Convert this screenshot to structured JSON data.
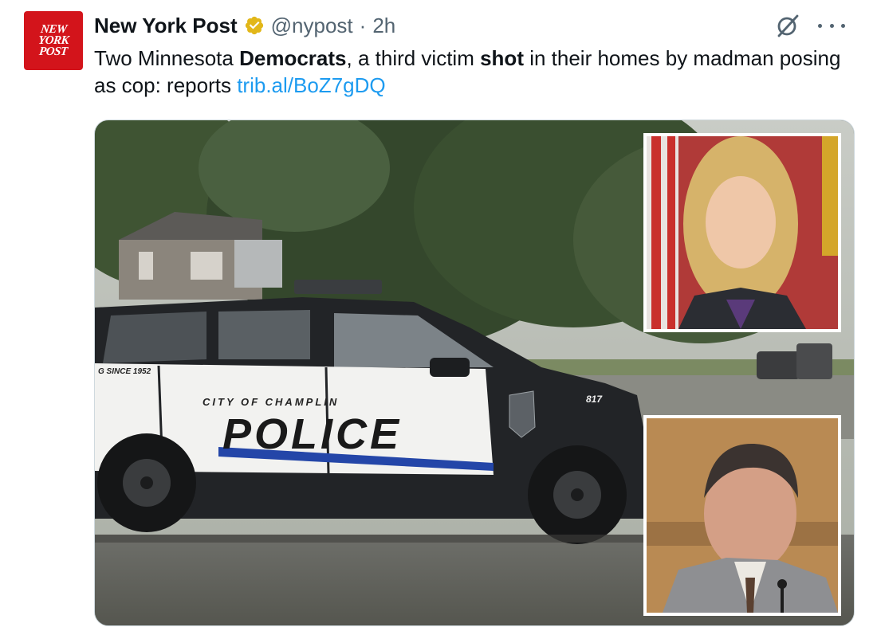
{
  "author": {
    "name": "New York Post",
    "handle": "@nypost",
    "separator": "·",
    "time": "2h",
    "avatar_lines": [
      "NEW",
      "YORK",
      "POST"
    ],
    "verified_badge": "verified-gold-icon",
    "brand_color": "#d3141b"
  },
  "tweet": {
    "text_parts": {
      "p1": "Two Minnesota ",
      "p2": "Democrats",
      "p3": ", a third victim ",
      "p4": "shot",
      "p5": " in their homes by madman posing as cop: reports ",
      "link": "trib.al/BoZ7gDQ"
    },
    "link_color": "#1d9bf0"
  },
  "media": {
    "car_text": {
      "city": "CITY OF CHAMPLIN",
      "police": "POLICE",
      "unit": "817",
      "since": "G SINCE 1952"
    }
  },
  "actions": {
    "grok_icon": "grok-icon",
    "more_icon": "more-dots-icon"
  }
}
